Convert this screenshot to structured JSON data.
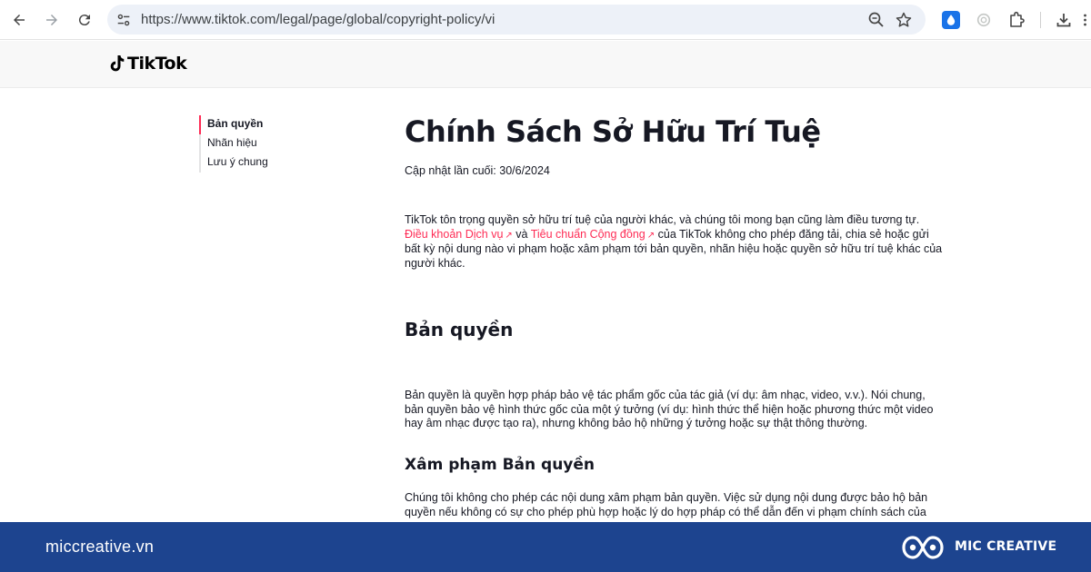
{
  "browser": {
    "url": "https://www.tiktok.com/legal/page/global/copyright-policy/vi"
  },
  "site": {
    "logo_text": "TikTok"
  },
  "toc": {
    "items": [
      {
        "label": "Bản quyền",
        "active": true
      },
      {
        "label": "Nhãn hiệu",
        "active": false
      },
      {
        "label": "Lưu ý chung",
        "active": false
      }
    ]
  },
  "article": {
    "title": "Chính Sách Sở Hữu Trí Tuệ",
    "updated": "Cập nhật lần cuối: 30/6/2024",
    "intro": {
      "part1": "TikTok tôn trọng quyền sở hữu trí tuệ của người khác, và chúng tôi mong bạn cũng làm điều tương tự. ",
      "link1": "Điều khoản Dịch vụ",
      "part2": " và ",
      "link2": "Tiêu chuẩn Cộng đồng",
      "part3": " của TikTok không cho phép đăng tải, chia sẻ hoặc gửi bất kỳ nội dung nào vi phạm hoặc xâm phạm tới bản quyền, nhãn hiệu hoặc quyền sở hữu trí tuệ khác của người khác.",
      "link_arrow": "↗"
    },
    "section_copyright": {
      "heading": "Bản quyền",
      "body": "Bản quyền là quyền hợp pháp bảo vệ tác phẩm gốc của tác giả (ví dụ: âm nhạc, video, v.v.). Nói chung, bản quyền bảo vệ hình thức gốc của một ý tưởng (ví dụ: hình thức thể hiện hoặc phương thức một video hay âm nhạc được tạo ra), nhưng không bảo hộ những ý tưởng hoặc sự thật thông thường."
    },
    "section_infringement": {
      "heading": "Xâm phạm Bản quyền",
      "body": "Chúng tôi không cho phép các nội dung xâm phạm bản quyền. Việc sử dụng nội dung được bảo hộ bản quyền nếu không có sự cho phép phù hợp hoặc lý do hợp pháp có thể dẫn đến vi phạm chính sách của"
    }
  },
  "brand_bar": {
    "url": "miccreative.vn",
    "name": "MIC CREATIVE",
    "background": "#1d448f"
  },
  "colors": {
    "accent": "#fe2c55",
    "text": "#161823"
  },
  "icons": [
    "back-icon",
    "forward-icon",
    "reload-icon",
    "site-info-icon",
    "zoom-icon",
    "star-icon",
    "drop-extension-icon",
    "ai-extension-icon",
    "puzzle-icon",
    "download-icon",
    "more-icon",
    "tiktok-note-icon",
    "mic-infinity-logo"
  ]
}
